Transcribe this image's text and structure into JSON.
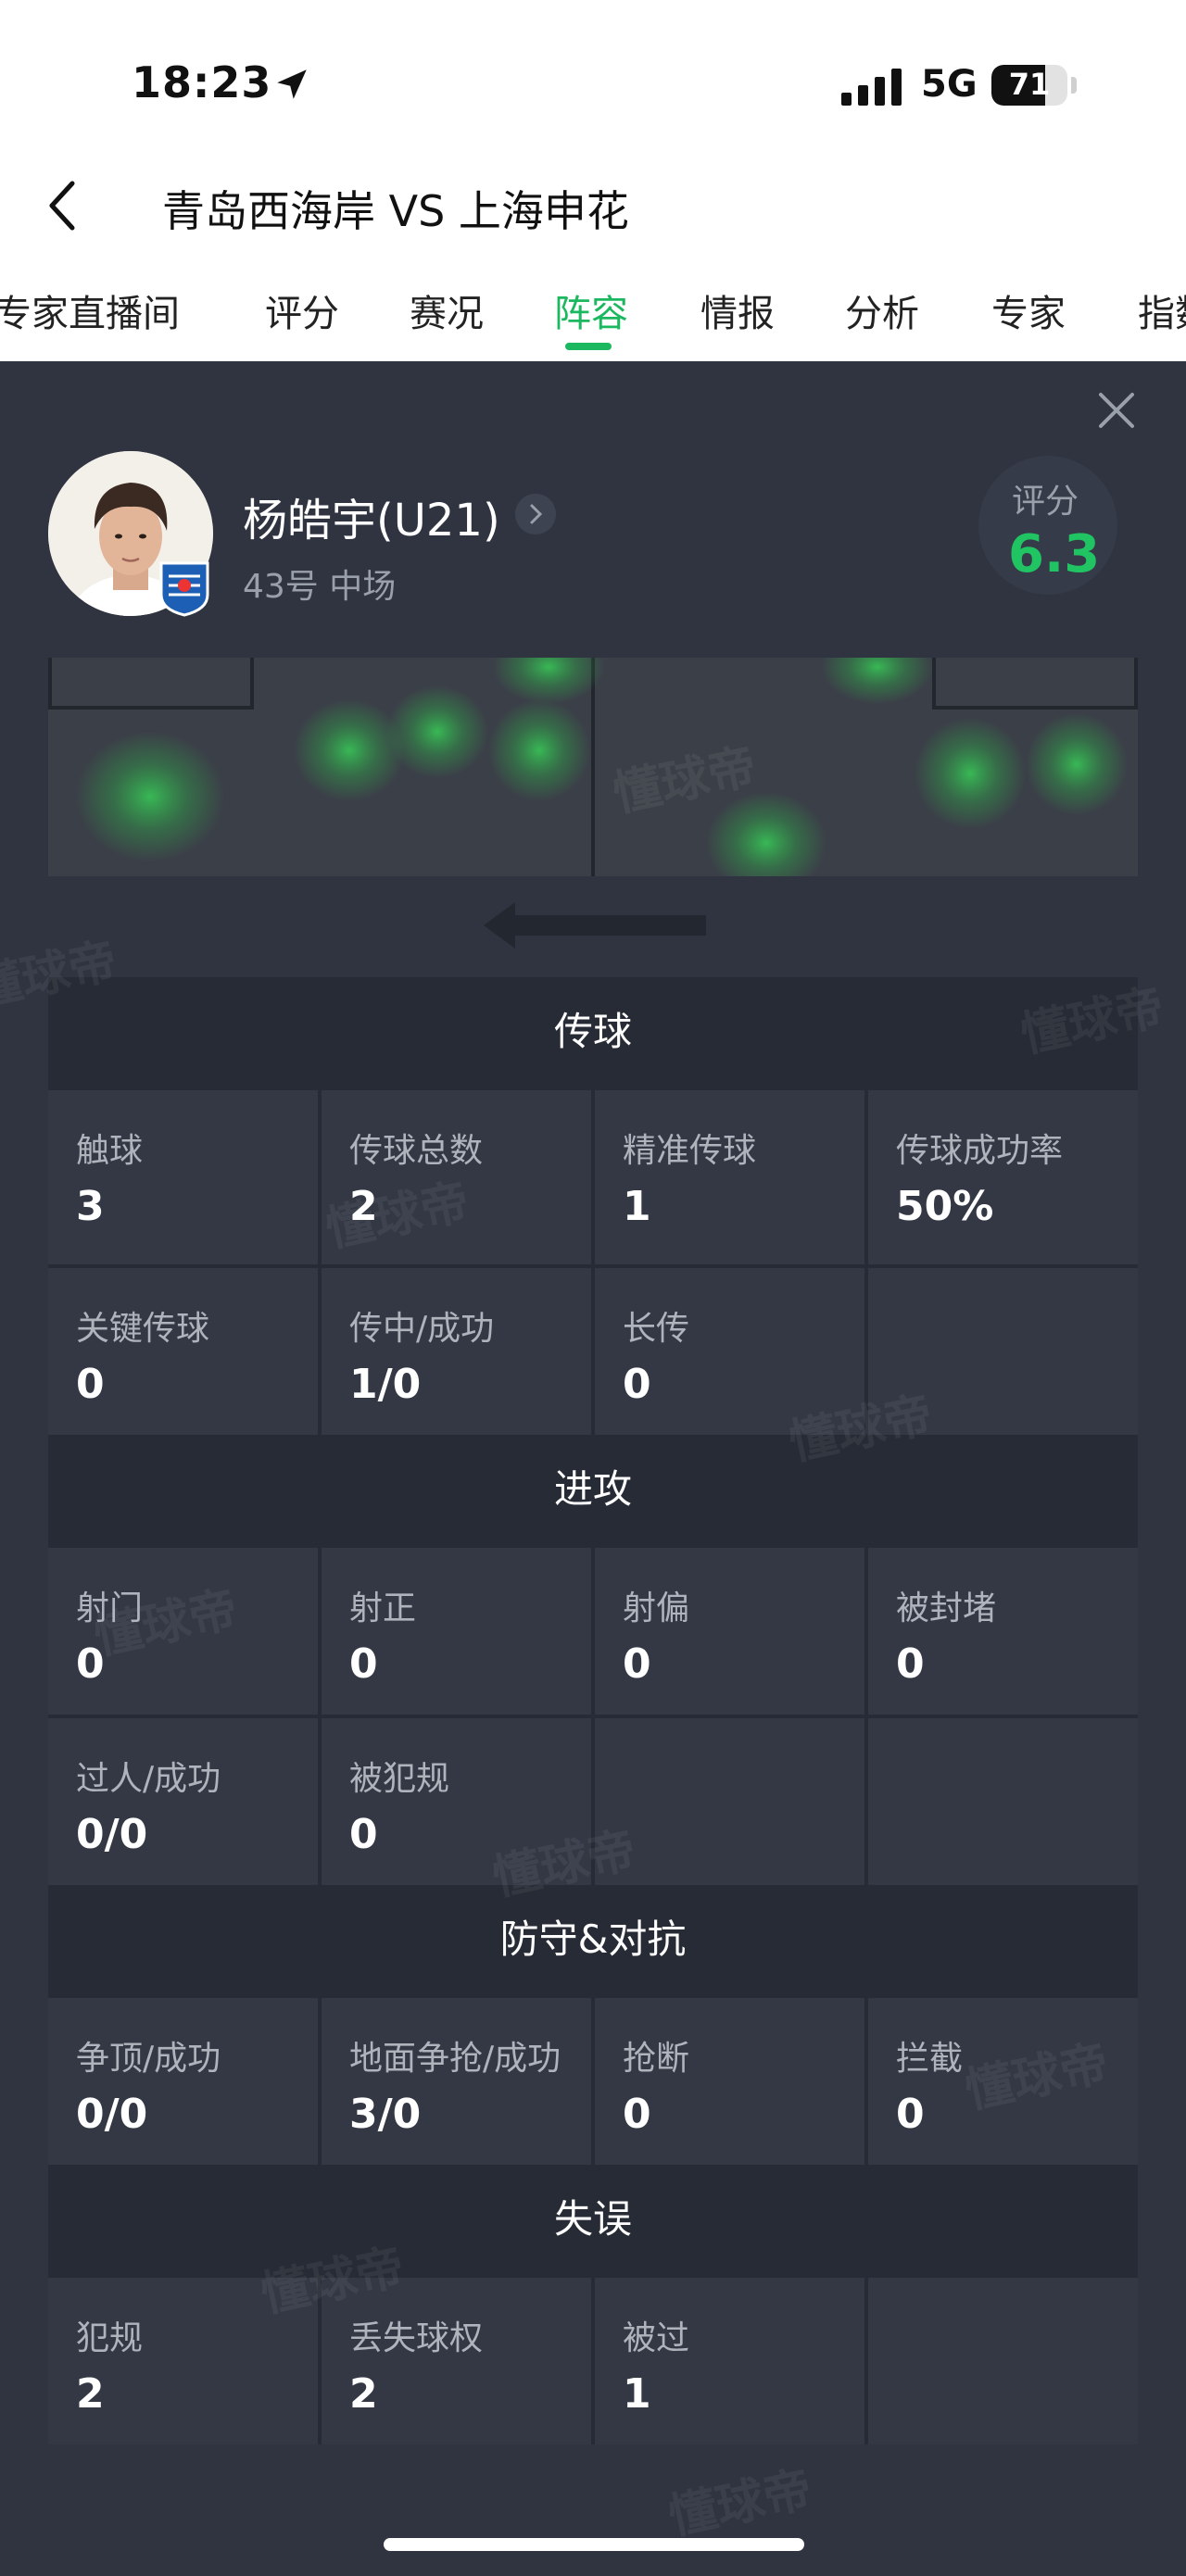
{
  "status_bar": {
    "time": "18:23",
    "network": "5G",
    "battery": "71",
    "battery_level": 0.71
  },
  "header": {
    "title": "青岛西海岸 VS 上海申花"
  },
  "tabs": [
    {
      "label": "专家直播间"
    },
    {
      "label": "评分"
    },
    {
      "label": "赛况"
    },
    {
      "label": "阵容"
    },
    {
      "label": "情报"
    },
    {
      "label": "分析"
    },
    {
      "label": "专家"
    },
    {
      "label": "指数"
    }
  ],
  "active_tab": "阵容",
  "player": {
    "name": "杨皓宇(U21)",
    "meta": "43号 中场"
  },
  "rating": {
    "label": "评分",
    "value": "6.3",
    "color": "#21c463"
  },
  "watermark": "懂球帝",
  "sections": [
    {
      "title": "传球",
      "stats": [
        {
          "label": "触球",
          "value": "3"
        },
        {
          "label": "传球总数",
          "value": "2"
        },
        {
          "label": "精准传球",
          "value": "1"
        },
        {
          "label": "传球成功率",
          "value": "50%"
        },
        {
          "label": "关键传球",
          "value": "0"
        },
        {
          "label": "传中/成功",
          "value": "1/0"
        },
        {
          "label": "长传",
          "value": "0"
        },
        {
          "label": "",
          "value": ""
        }
      ]
    },
    {
      "title": "进攻",
      "stats": [
        {
          "label": "射门",
          "value": "0"
        },
        {
          "label": "射正",
          "value": "0"
        },
        {
          "label": "射偏",
          "value": "0"
        },
        {
          "label": "被封堵",
          "value": "0"
        },
        {
          "label": "过人/成功",
          "value": "0/0"
        },
        {
          "label": "被犯规",
          "value": "0"
        },
        {
          "label": "",
          "value": ""
        },
        {
          "label": "",
          "value": ""
        }
      ]
    },
    {
      "title": "防守&对抗",
      "stats": [
        {
          "label": "争顶/成功",
          "value": "0/0"
        },
        {
          "label": "地面争抢/成功",
          "value": "3/0"
        },
        {
          "label": "抢断",
          "value": "0"
        },
        {
          "label": "拦截",
          "value": "0"
        }
      ]
    },
    {
      "title": "失误",
      "stats": [
        {
          "label": "犯规",
          "value": "2"
        },
        {
          "label": "丢失球权",
          "value": "2"
        },
        {
          "label": "被过",
          "value": "1"
        },
        {
          "label": "",
          "value": ""
        }
      ]
    }
  ],
  "colors": {
    "accent": "#1bb85f",
    "panel_bg": "#2f3440",
    "cell_bg": "#333844",
    "header_bg": "#272b35"
  }
}
